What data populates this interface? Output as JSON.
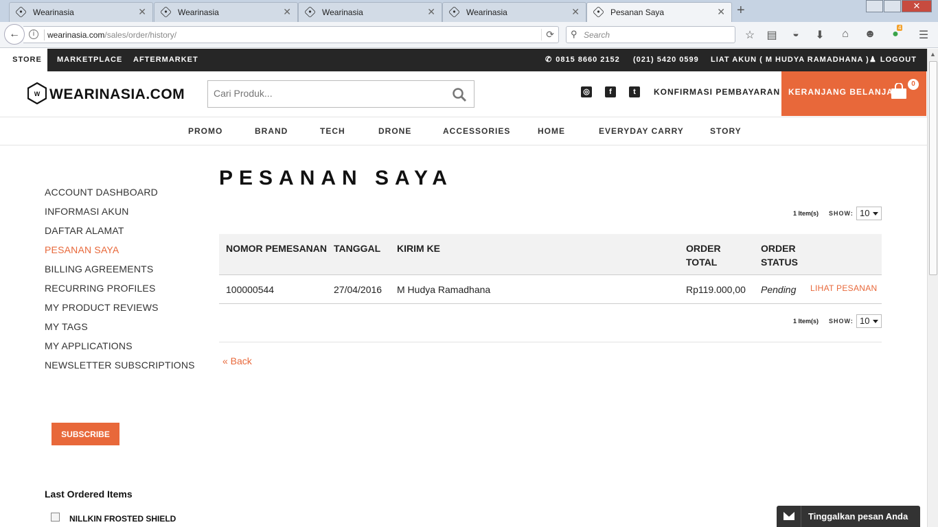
{
  "browser": {
    "tabs": [
      {
        "title": "Wearinasia"
      },
      {
        "title": "Wearinasia"
      },
      {
        "title": "Wearinasia"
      },
      {
        "title": "Wearinasia"
      },
      {
        "title": "Pesanan Saya"
      }
    ],
    "url_host": "wearinasia.com",
    "url_path": "/sales/order/history/",
    "search_placeholder": "Search",
    "badge_count": "4"
  },
  "topbar": {
    "store": "STORE",
    "marketplace": "MARKETPLACE",
    "aftermarket": "AFTERMARKET",
    "phone1": "0815 8660 2152",
    "phone2": "(021) 5420 0599",
    "account": "LIAT AKUN ( M HUDYA RAMADHANA )",
    "logout": "LOGOUT"
  },
  "header": {
    "logo_text": "WEARINASIA.COM",
    "search_placeholder": "Cari Produk...",
    "konfirmasi": "KONFIRMASI PEMBAYARAN",
    "cart_label": "KERANJANG BELANJA",
    "cart_count": "0"
  },
  "mainnav": [
    "PROMO",
    "BRAND",
    "TECH",
    "DRONE",
    "ACCESSORIES",
    "HOME",
    "EVERYDAY CARRY",
    "STORY"
  ],
  "sidebar": {
    "items": [
      "ACCOUNT DASHBOARD",
      "INFORMASI AKUN",
      "DAFTAR ALAMAT",
      "PESANAN SAYA",
      "BILLING AGREEMENTS",
      "RECURRING PROFILES",
      "MY PRODUCT REVIEWS",
      "MY TAGS",
      "MY APPLICATIONS",
      "NEWSLETTER SUBSCRIPTIONS"
    ],
    "active_index": 3,
    "subscribe": "SUBSCRIBE",
    "last_ordered_title": "Last Ordered Items",
    "last_ordered_item": "NILLKIN FROSTED SHIELD"
  },
  "main": {
    "title": "PESANAN SAYA",
    "items_count": "1 Item(s)",
    "show_label": "SHOW:",
    "show_value": "10",
    "columns": {
      "nomor": "NOMOR PEMESANAN",
      "tanggal": "TANGGAL",
      "kirim": "KIRIM KE",
      "total_l1": "ORDER",
      "total_l2": "TOTAL",
      "status_l1": "ORDER",
      "status_l2": "STATUS"
    },
    "orders": [
      {
        "nomor": "100000544",
        "tanggal": "27/04/2016",
        "kirim": "M Hudya Ramadhana",
        "total": "Rp119.000,00",
        "status": "Pending",
        "view": "LIHAT PESANAN"
      }
    ],
    "back": "« Back"
  },
  "chat": {
    "label": "Tinggalkan pesan Anda"
  },
  "colors": {
    "accent": "#e8683a",
    "topbar": "#262626"
  }
}
